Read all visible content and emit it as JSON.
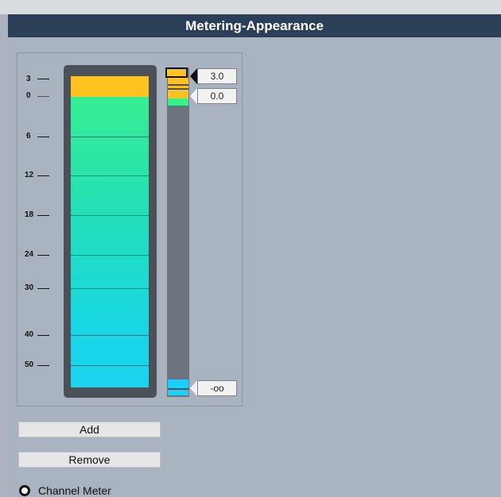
{
  "title": "Metering-Appearance",
  "scale": {
    "labels": [
      "3",
      "0",
      "6",
      "12",
      "18",
      "24",
      "30",
      "40",
      "50"
    ]
  },
  "meter": {
    "max_tag": "3.0",
    "zero_tag": "0.0",
    "min_tag": "-oo"
  },
  "buttons": {
    "add": "Add",
    "remove": "Remove"
  },
  "options": {
    "channel_meter": "Channel Meter"
  },
  "colors": {
    "yellow": "#ffc21e",
    "green": "#39f08b",
    "cyan": "#1ad0ff",
    "title_bar": "#2b4058"
  }
}
